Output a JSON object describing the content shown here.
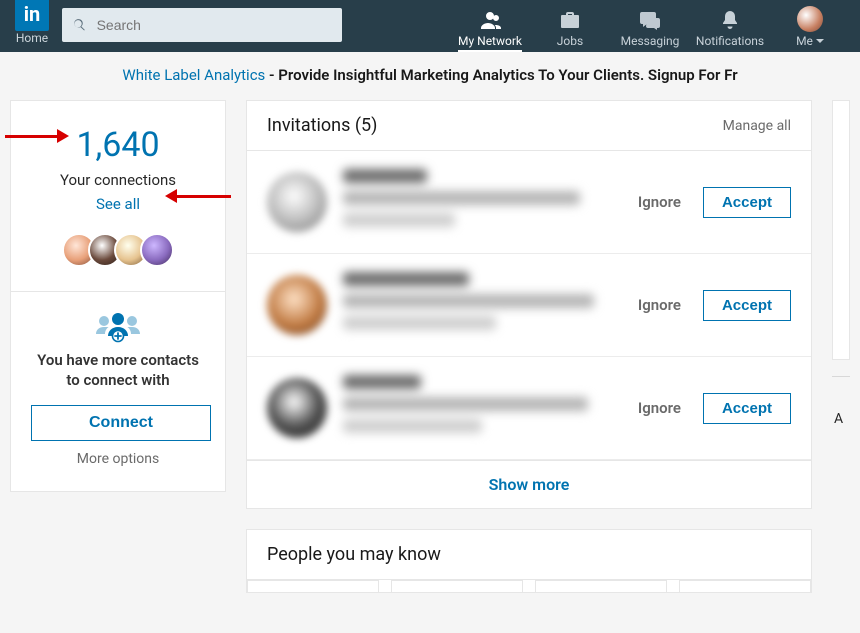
{
  "nav": {
    "home": "Home",
    "search_placeholder": "Search",
    "items": [
      {
        "label": "My Network",
        "active": true
      },
      {
        "label": "Jobs"
      },
      {
        "label": "Messaging"
      },
      {
        "label": "Notifications"
      },
      {
        "label": "Me"
      }
    ]
  },
  "promo": {
    "brand": "White Label Analytics",
    "text": " - Provide Insightful Marketing Analytics To Your Clients. Signup For Fr"
  },
  "connections": {
    "count": "1,640",
    "label": "Your connections",
    "see_all": "See all",
    "contacts_headline": "You have more contacts to connect with",
    "connect": "Connect",
    "more_options": "More options"
  },
  "invitations": {
    "title": "Invitations (5)",
    "manage": "Manage all",
    "ignore": "Ignore",
    "accept": "Accept",
    "show_more": "Show more"
  },
  "pymk": {
    "title": "People you may know"
  },
  "right": {
    "letter": "A"
  }
}
